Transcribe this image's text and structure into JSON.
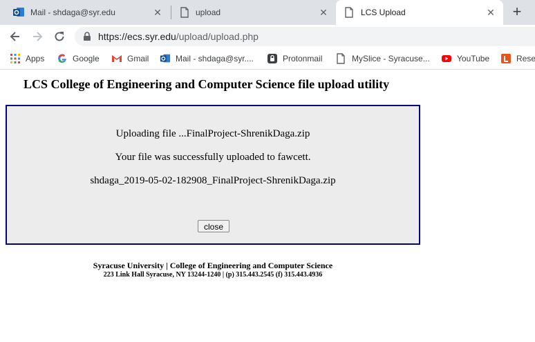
{
  "tabs": [
    {
      "title": "Mail - shdaga@syr.edu",
      "icon": "outlook-icon",
      "close": "✕"
    },
    {
      "title": "upload",
      "icon": "page-icon",
      "close": "✕"
    },
    {
      "title": "LCS Upload",
      "icon": "page-icon",
      "close": "✕",
      "active": true
    }
  ],
  "new_tab": "+",
  "url": {
    "host": "https://ecs.syr.edu",
    "path": "/upload/upload.php"
  },
  "bookmarks": [
    {
      "label": "Apps",
      "icon": "apps-grid-icon"
    },
    {
      "label": "Google",
      "icon": "google-icon"
    },
    {
      "label": "Gmail",
      "icon": "gmail-icon"
    },
    {
      "label": "Mail - shdaga@syr....",
      "icon": "outlook-icon"
    },
    {
      "label": "Protonmail",
      "icon": "protonmail-icon"
    },
    {
      "label": "MySlice - Syracuse...",
      "icon": "page-icon"
    },
    {
      "label": "YouTube",
      "icon": "youtube-icon"
    },
    {
      "label": "Reser",
      "icon": "bookmark-l-icon"
    }
  ],
  "page": {
    "title": "LCS College of Engineering and Computer Science file upload utility",
    "uploading": "Uploading file ...FinalProject-ShrenikDaga.zip",
    "success": "Your file was successfully uploaded to fawcett.",
    "filename": "shdaga_2019-05-02-182908_FinalProject-ShrenikDaga.zip",
    "close_label": "close",
    "footer_line1": "Syracuse University | College of Engineering and Computer Science",
    "footer_line2": "223 Link Hall Syracuse, NY 13244-1240 | (p) 315.443.2545 (f) 315.443.4936"
  },
  "colors": {
    "box_border": "#00008b",
    "box_bg": "#ececec",
    "tabstrip": "#dee1e6"
  }
}
